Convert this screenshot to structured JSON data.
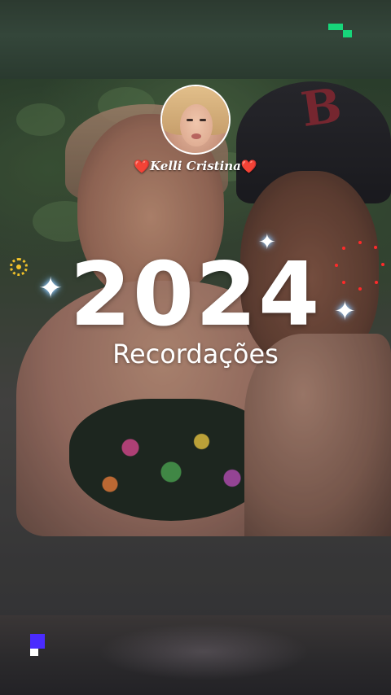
{
  "profile": {
    "name": "Kelli Cristina",
    "heart_left": "❤️",
    "heart_right": "❤️"
  },
  "title": {
    "year": "2024",
    "subtitle": "Recordações"
  },
  "cap_logo": "B",
  "decorations": {
    "sparkle_glyph": "✦",
    "sparkle_color": "#9fd4ff",
    "sun_color": "#f2c22a",
    "dots_color": "#ff2a2a",
    "corner_top_color": "#17d67a",
    "corner_bottom_color": "#4a2bff"
  }
}
